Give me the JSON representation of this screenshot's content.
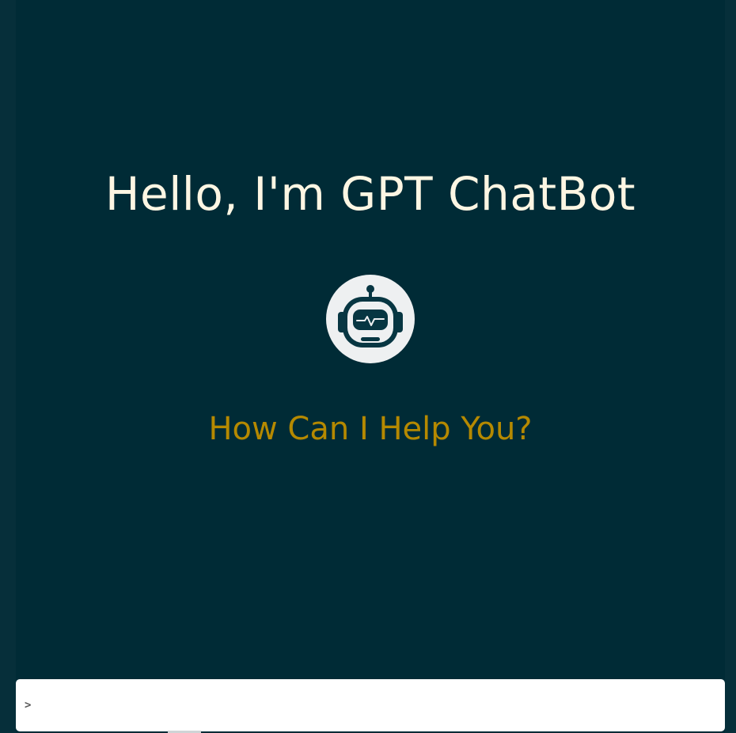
{
  "header": {
    "title": "Hello, I'm GPT ChatBot"
  },
  "avatar": {
    "icon": "robot-icon",
    "background_color": "#eef0f1",
    "icon_color": "#073642"
  },
  "main": {
    "subtitle": "How Can I Help You?"
  },
  "chat": {
    "prompt_symbol": ">",
    "input_value": "",
    "input_placeholder": ""
  },
  "colors": {
    "background": "#002b36",
    "title": "#fdf6e3",
    "accent": "#b58900"
  }
}
